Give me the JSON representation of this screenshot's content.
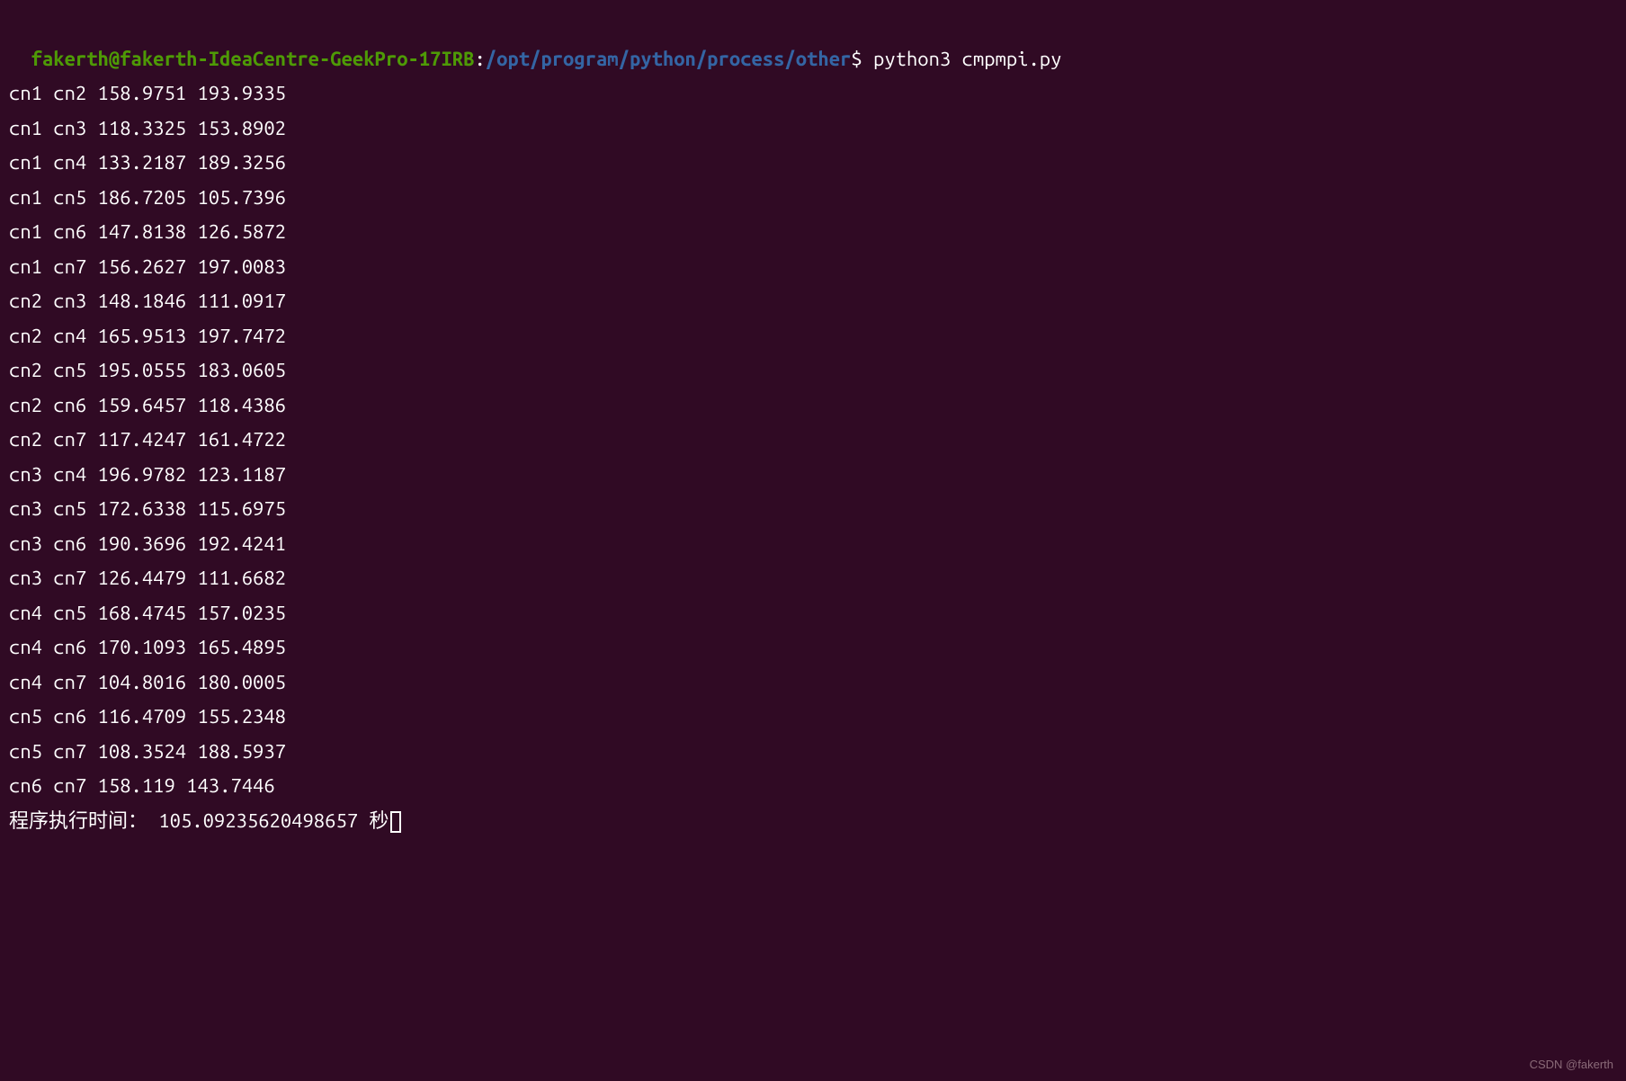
{
  "prompt": {
    "user_host": "fakerth@fakerth-IdeaCentre-GeekPro-17IRB",
    "colon": ":",
    "path": "/opt/program/python/process/other",
    "dollar": "$",
    "command": "python3 cmpmpi.py"
  },
  "output_lines": [
    "cn1 cn2 158.9751 193.9335",
    "cn1 cn3 118.3325 153.8902",
    "cn1 cn4 133.2187 189.3256",
    "cn1 cn5 186.7205 105.7396",
    "cn1 cn6 147.8138 126.5872",
    "cn1 cn7 156.2627 197.0083",
    "cn2 cn3 148.1846 111.0917",
    "cn2 cn4 165.9513 197.7472",
    "cn2 cn5 195.0555 183.0605",
    "cn2 cn6 159.6457 118.4386",
    "cn2 cn7 117.4247 161.4722",
    "cn3 cn4 196.9782 123.1187",
    "cn3 cn5 172.6338 115.6975",
    "cn3 cn6 190.3696 192.4241",
    "cn3 cn7 126.4479 111.6682",
    "cn4 cn5 168.4745 157.0235",
    "cn4 cn6 170.1093 165.4895",
    "cn4 cn7 104.8016 180.0005",
    "cn5 cn6 116.4709 155.2348",
    "cn5 cn7 108.3524 188.5937",
    "cn6 cn7 158.119 143.7446"
  ],
  "execution_time_line": "程序执行时间： 105.09235620498657 秒",
  "watermark": "CSDN @fakerth"
}
